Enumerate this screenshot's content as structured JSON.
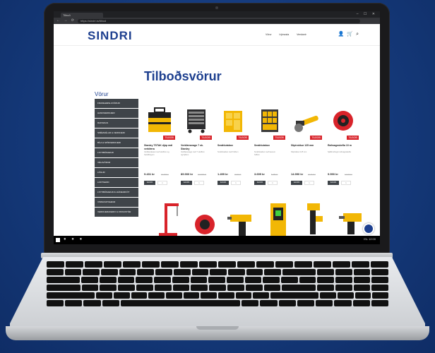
{
  "browser": {
    "tab_title": "Tilboð",
    "address": "https://sindri.is/tilbod"
  },
  "site": {
    "logo": "SINDRI",
    "nav": [
      "Vörur",
      "Þjónusta",
      "Verslanir"
    ],
    "page_title": "Tilboðsvörur",
    "sidebar_title": "Vörur",
    "sidebar_items": [
      "FRAMLEIÐSLUVÖRUR",
      "HANDVERKFÆRI",
      "RAFMAGN",
      "SMÍÐAVÉLAR & VERKFÆRI",
      "BÍLA & SPÍRVERKFÆRI",
      "LYFTIBÚNAÐUR",
      "VÉLAVÖRUR",
      "LÖGUR",
      "LOFTKERFI",
      "LYFTIBÚNAÐUR & HLÍFÐARFÖT",
      "VINNUFATNAÐUR",
      "VERKFÆRAKERFI & VINNUSTÖÐ"
    ],
    "products": [
      {
        "name": "Stanley TSTAK djúp mál verkfæra",
        "desc": "Verkfærakassi með skúffum og handföngum",
        "price": "9.431 kr",
        "old": "13.473 kr",
        "badge": "TILBOÐ",
        "icon": "toolbox-icon"
      },
      {
        "name": "Verkfæravagn 7 sk. Stanley",
        "desc": "Verkfæravagn með 7 skúffum og hjólum",
        "price": "89.900 kr",
        "old": "119.900 kr",
        "badge": "TILBOÐ",
        "icon": "tool-cart-icon"
      },
      {
        "name": "Smáhlutabox",
        "desc": "Smáhlutabox með hólfum",
        "price": "1.499 kr",
        "old": "2.141 kr",
        "badge": "TILBOÐ",
        "icon": "organizer-icon"
      },
      {
        "name": "Smáhlutabox",
        "desc": "Smáhlutabox með lausum hólfum",
        "price": "3.699 kr",
        "old": "5.284 kr",
        "badge": "TILBOÐ",
        "icon": "organizer-icon"
      },
      {
        "name": "Slípirokkur 125 mm",
        "desc": "Slípirokkur 125 mm",
        "price": "14.990 kr",
        "old": "21.414 kr",
        "badge": "TILBOÐ",
        "icon": "grinder-icon"
      },
      {
        "name": "Rafmagnskefla 10 m",
        "desc": "Sjálfinndregin rafmagnskefla",
        "price": "9.990 kr",
        "old": "14.271 kr",
        "badge": "TILBOÐ",
        "icon": "cable-reel-icon"
      }
    ],
    "buy_label": "KAUPA",
    "qty": "1"
  },
  "taskbar": {
    "tray": "ISL 12:00"
  },
  "colors": {
    "brand": "#1d3f8f",
    "badge": "#d8232a",
    "sidebar": "#3f4449"
  }
}
